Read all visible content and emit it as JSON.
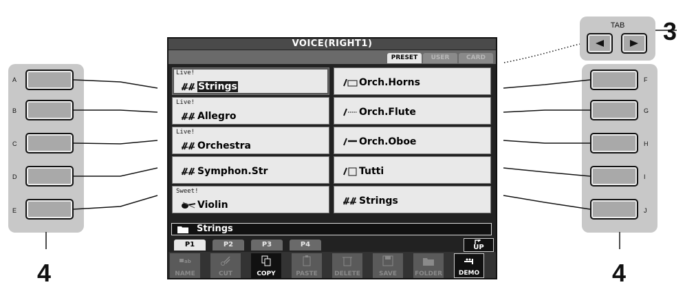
{
  "screen": {
    "title": "VOICE(RIGHT1)",
    "tabs": [
      {
        "label": "PRESET",
        "active": true
      },
      {
        "label": "USER",
        "active": false
      },
      {
        "label": "CARD",
        "active": false
      }
    ],
    "voices_left": [
      {
        "sub": "Live!",
        "name": "Strings",
        "selected": true
      },
      {
        "sub": "Live!",
        "name": "Allegro"
      },
      {
        "sub": "Live!",
        "name": "Orchestra"
      },
      {
        "sub": "",
        "name": "Symphon.Str"
      },
      {
        "sub": "Sweet!",
        "name": "Violin"
      }
    ],
    "voices_right": [
      {
        "sub": "",
        "name": "Orch.Horns"
      },
      {
        "sub": "",
        "name": "Orch.Flute"
      },
      {
        "sub": "",
        "name": "Orch.Oboe"
      },
      {
        "sub": "",
        "name": "Tutti"
      },
      {
        "sub": "",
        "name": "Strings"
      }
    ],
    "folder": "Strings",
    "pages": [
      "P1",
      "P2",
      "P3",
      "P4"
    ],
    "active_page": "P1",
    "up_label": "UP",
    "functions": [
      "NAME",
      "CUT",
      "COPY",
      "PASTE",
      "DELETE",
      "SAVE",
      "FOLDER",
      "DEMO"
    ]
  },
  "left_buttons": [
    "A",
    "B",
    "C",
    "D",
    "E"
  ],
  "right_buttons": [
    "F",
    "G",
    "H",
    "I",
    "J"
  ],
  "tab_label": "TAB",
  "step_tab": "3",
  "step_left": "4",
  "step_right": "4",
  "colors": {
    "lcd_bg": "#222222",
    "cell_bg": "#e9e9e9",
    "panel": "#c8c8c8"
  }
}
